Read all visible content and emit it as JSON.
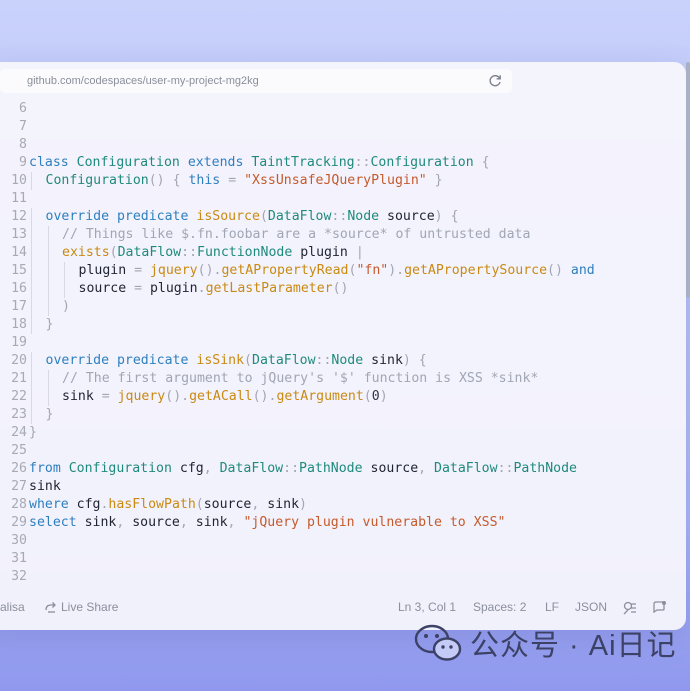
{
  "browser": {
    "url": "github.com/codespaces/user-my-project-mg2kg",
    "reload_icon": "reload-icon"
  },
  "editor": {
    "line_numbers": [
      "6",
      "7",
      "8",
      "9",
      "10",
      "11",
      "12",
      "13",
      "14",
      "15",
      "16",
      "17",
      "18",
      "19",
      "20",
      "21",
      "22",
      "23",
      "24",
      "25",
      "26",
      "27",
      "28",
      "29",
      "30",
      "31",
      "32"
    ],
    "lines": [
      [],
      [],
      [],
      [
        [
          "kw",
          "class"
        ],
        [
          "id",
          " "
        ],
        [
          "ty",
          "Configuration"
        ],
        [
          "id",
          " "
        ],
        [
          "kw",
          "extends"
        ],
        [
          "id",
          " "
        ],
        [
          "ty",
          "TaintTracking"
        ],
        [
          "pun",
          "::"
        ],
        [
          "ty",
          "Configuration"
        ],
        [
          "id",
          " "
        ],
        [
          "pun",
          "{"
        ]
      ],
      [
        [
          "ty",
          "Configuration"
        ],
        [
          "pun",
          "()"
        ],
        [
          "id",
          " "
        ],
        [
          "pun",
          "{"
        ],
        [
          "id",
          " "
        ],
        [
          "kw",
          "this"
        ],
        [
          "id",
          " "
        ],
        [
          "pun",
          "="
        ],
        [
          "id",
          " "
        ],
        [
          "str",
          "\"XssUnsafeJQueryPlugin\""
        ],
        [
          "id",
          " "
        ],
        [
          "pun",
          "}"
        ]
      ],
      [],
      [
        [
          "kw",
          "override"
        ],
        [
          "id",
          " "
        ],
        [
          "kw",
          "predicate"
        ],
        [
          "id",
          " "
        ],
        [
          "fn",
          "isSource"
        ],
        [
          "pun",
          "("
        ],
        [
          "ty",
          "DataFlow"
        ],
        [
          "pun",
          "::"
        ],
        [
          "ty",
          "Node"
        ],
        [
          "id",
          " source"
        ],
        [
          "pun",
          ")"
        ],
        [
          "id",
          " "
        ],
        [
          "pun",
          "{"
        ]
      ],
      [
        [
          "cm",
          "// Things like $.fn.foobar are a *source* of untrusted data"
        ]
      ],
      [
        [
          "fn",
          "exists"
        ],
        [
          "pun",
          "("
        ],
        [
          "ty",
          "DataFlow"
        ],
        [
          "pun",
          "::"
        ],
        [
          "ty",
          "FunctionNode"
        ],
        [
          "id",
          " plugin "
        ],
        [
          "pun",
          "|"
        ]
      ],
      [
        [
          "id",
          "plugin "
        ],
        [
          "pun",
          "="
        ],
        [
          "id",
          " "
        ],
        [
          "fn",
          "jquery"
        ],
        [
          "pun",
          "()."
        ],
        [
          "fn",
          "getAPropertyRead"
        ],
        [
          "pun",
          "("
        ],
        [
          "str",
          "\"fn\""
        ],
        [
          "pun",
          ")."
        ],
        [
          "fn",
          "getAPropertySource"
        ],
        [
          "pun",
          "()"
        ],
        [
          "id",
          " "
        ],
        [
          "kw",
          "and"
        ]
      ],
      [
        [
          "id",
          "source "
        ],
        [
          "pun",
          "="
        ],
        [
          "id",
          " plugin"
        ],
        [
          "pun",
          "."
        ],
        [
          "fn",
          "getLastParameter"
        ],
        [
          "pun",
          "()"
        ]
      ],
      [
        [
          "pun",
          ")"
        ]
      ],
      [
        [
          "pun",
          "}"
        ]
      ],
      [],
      [
        [
          "kw",
          "override"
        ],
        [
          "id",
          " "
        ],
        [
          "kw",
          "predicate"
        ],
        [
          "id",
          " "
        ],
        [
          "fn",
          "isSink"
        ],
        [
          "pun",
          "("
        ],
        [
          "ty",
          "DataFlow"
        ],
        [
          "pun",
          "::"
        ],
        [
          "ty",
          "Node"
        ],
        [
          "id",
          " sink"
        ],
        [
          "pun",
          ")"
        ],
        [
          "id",
          " "
        ],
        [
          "pun",
          "{"
        ]
      ],
      [
        [
          "cm",
          "// The first argument to jQuery's '$' function is XSS *sink*"
        ]
      ],
      [
        [
          "id",
          "sink "
        ],
        [
          "pun",
          "="
        ],
        [
          "id",
          " "
        ],
        [
          "fn",
          "jquery"
        ],
        [
          "pun",
          "()."
        ],
        [
          "fn",
          "getACall"
        ],
        [
          "pun",
          "()."
        ],
        [
          "fn",
          "getArgument"
        ],
        [
          "pun",
          "("
        ],
        [
          "num",
          "0"
        ],
        [
          "pun",
          ")"
        ]
      ],
      [
        [
          "pun",
          "}"
        ]
      ],
      [
        [
          "pun",
          "}"
        ]
      ],
      [],
      [
        [
          "kw",
          "from"
        ],
        [
          "id",
          " "
        ],
        [
          "ty",
          "Configuration"
        ],
        [
          "id",
          " cfg"
        ],
        [
          "pun",
          ","
        ],
        [
          "id",
          " "
        ],
        [
          "ty",
          "DataFlow"
        ],
        [
          "pun",
          "::"
        ],
        [
          "ty",
          "PathNode"
        ],
        [
          "id",
          " source"
        ],
        [
          "pun",
          ","
        ],
        [
          "id",
          " "
        ],
        [
          "ty",
          "DataFlow"
        ],
        [
          "pun",
          "::"
        ],
        [
          "ty",
          "PathNode"
        ]
      ],
      [
        [
          "id",
          "sink"
        ]
      ],
      [
        [
          "kw",
          "where"
        ],
        [
          "id",
          " cfg"
        ],
        [
          "pun",
          "."
        ],
        [
          "fn",
          "hasFlowPath"
        ],
        [
          "pun",
          "("
        ],
        [
          "id",
          "source"
        ],
        [
          "pun",
          ","
        ],
        [
          "id",
          " sink"
        ],
        [
          "pun",
          ")"
        ]
      ],
      [
        [
          "kw",
          "select"
        ],
        [
          "id",
          " sink"
        ],
        [
          "pun",
          ","
        ],
        [
          "id",
          " source"
        ],
        [
          "pun",
          ","
        ],
        [
          "id",
          " sink"
        ],
        [
          "pun",
          ","
        ],
        [
          "id",
          " "
        ],
        [
          "str",
          "\"jQuery plugin vulnerable to XSS\""
        ]
      ],
      [],
      [],
      []
    ],
    "indents": [
      0,
      0,
      0,
      0,
      1,
      0,
      1,
      2,
      2,
      3,
      3,
      2,
      1,
      0,
      1,
      2,
      2,
      1,
      0,
      0,
      0,
      0,
      0,
      0,
      0,
      0,
      0
    ]
  },
  "statusbar": {
    "user": "alisa",
    "live_share": "Live Share",
    "position": "Ln 3, Col 1",
    "spaces": "Spaces: 2",
    "eol": "LF",
    "language": "JSON",
    "icons": [
      "live-share-icon",
      "feedback-icon",
      "notifications-icon"
    ]
  },
  "watermark": {
    "text": "公众号 · Ai日记"
  },
  "colors": {
    "keyword": "#2e7fbf",
    "type": "#1f8a7c",
    "function": "#c98a12",
    "string": "#c55a2b",
    "comment": "#a0a6b3"
  }
}
